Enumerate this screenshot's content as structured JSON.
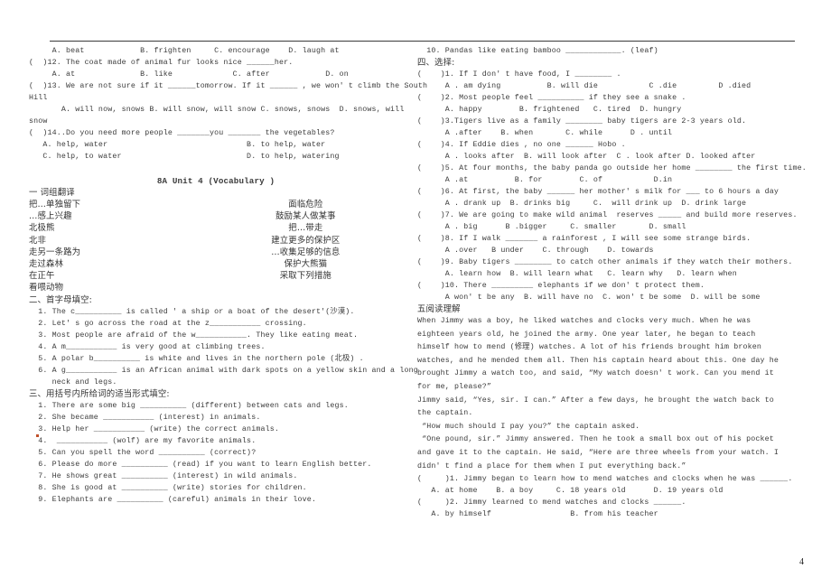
{
  "document": {
    "page_number": "4",
    "rule_divider": true
  },
  "left_column": {
    "carryover_lines": [
      "     A. beat            B. frighten     C. encourage    D. laugh at",
      "(  )12. The coat made of animal fur looks nice ______her.",
      "     A. at              B. like             C. after            D. on",
      "(  )13. We are not sure if it ______tomorrow. If it ______ , we won' t climb the South",
      "Hill",
      "       A. will now, snows B. will snow, will snow C. snows, snows  D. snows, will",
      "snow",
      "(  )14..Do you need more people _______you _______ the vegetables?",
      "   A. help, water                              B. to help, water",
      "   C. help, to water                           D. to help, watering"
    ],
    "title": "8A Unit 4 (Vocabulary )",
    "section_one": {
      "heading": "一 词组翻译",
      "pairs": [
        {
          "left": "把…单独留下",
          "right": "面临危险"
        },
        {
          "left": "…感上兴趣",
          "right": "鼓励某人做某事"
        },
        {
          "left": "北极熊",
          "right": "把…带走"
        },
        {
          "left": "北非",
          "right": "建立更多的保护区"
        },
        {
          "left": "走另一条路为",
          "right": "…收集足够的信息"
        },
        {
          "left": "走过森林",
          "right": "保护大熊猫"
        },
        {
          "left": "在正午",
          "right": "采取下列措施"
        },
        {
          "left": "看喂动物",
          "right": ""
        }
      ]
    },
    "section_two": {
      "heading": "二、首字母填空:",
      "items": [
        "  1. The c__________ is called ' a ship or a boat of the desert'(沙漠).",
        "  2. Let' s go across the road at the z___________ crossing.",
        "  3. Most people are afraid of the w___________. They like eating meat.",
        "  4. A m___________ is very good at climbing trees.",
        "  5. A polar b__________ is white and lives in the northern pole (北极) .",
        "  6. A g___________ is an African animal with dark spots on a yellow skin and a long",
        "     neck and legs."
      ]
    },
    "section_three": {
      "heading": "三、用括号内所给词的适当形式填空:",
      "items": [
        "  1. There are some big __________ (different) between cats and legs.",
        "  2. She became ___________ (interest) in animals.",
        "  3. Help her ___________ (write) the correct animals.",
        "  4.  ___________ (wolf) are my favorite animals.",
        "  5. Can you spell the word __________ (correct)?",
        "  6. Please do more __________ (read) if you want to learn English better.",
        "  7. He shows great __________ (interest) in wild animals.",
        "  8. She is good at __________ (write) stories for children.",
        "  9. Elephants are __________ (careful) animals in their love."
      ]
    }
  },
  "right_column": {
    "carryover_item_ten": "  10. Pandas like eating bamboo ____________. (leaf)",
    "section_four": {
      "heading": "四、选择:",
      "items": [
        "(    )1. If I don' t have food, I ________ .",
        "      A . am dying          B. will die           C .die         D .died",
        "(    )2. Most people feel __________ if they see a snake .",
        "      A. happy        B. frightened   C. tired  D. hungry",
        "(    )3.Tigers live as a family ________ baby tigers are 2-3 years old.",
        "      A .after    B. when       C. while      D . until",
        "(    )4. If Eddie dies , no one ______ Hobo .",
        "      A . looks after  B. will look after  C . look after D. looked after",
        "(    )5. At four months, the baby panda go outside her home ________ the first time.",
        "      A .at          B. for        C. of           D.in",
        "(    )6. At first, the baby ______ her mother' s milk for ___ to 6 hours a day",
        "      A . drank up  B. drinks big     C.  will drink up  D. drink large",
        "(    )7. We are going to make wild animal  reserves _____ and build more reserves.",
        "      A . big      B .bigger     C. smaller       D. small",
        "(    )8. If I walk _______ a rainforest , I will see some strange birds.",
        "      A .over   B under    C. through    D. towards",
        "(    )9. Baby tigers ________ to catch other animals if they watch their mothers.",
        "      A. learn how  B. will learn what   C. learn why   D. learn when",
        "(    )10. There _________ elephants if we don' t protect them.",
        "      A won' t be any  B. will have no  C. won' t be some  D. will be some"
      ]
    },
    "section_five": {
      "heading": "五阅读理解",
      "passage": [
        "When Jimmy was a boy, he liked watches and clocks very much. When he was eighteen years old, he joined the army. One year later, he began to teach himself how to mend (修理) watches. A lot of his friends brought him broken watches, and he mended them all. Then his captain heard about this. One day he brought Jimmy a watch too, and said, “My watch doesn' t work. Can you mend it for me, please?”",
        "Jimmy said, “Yes, sir. I can.” After a few days, he brought the watch back to the captain.",
        " “How much should I pay you?” the captain asked.",
        " “One pound, sir.” Jimmy answered. Then he took a small box out of his pocket and gave it to the captain. He said, “Here are three wheels from your watch. I didn' t find a place for them when I put everything back.”"
      ],
      "questions": [
        "(     )1. Jimmy began to learn how to mend watches and clocks when he was ______.",
        "   A. at home    B. a boy     C. 18 years old      D. 19 years old",
        "(     )2. Jimmy learned to mend watches and clocks ______.",
        "   A. by himself                 B. from his teacher"
      ]
    }
  }
}
